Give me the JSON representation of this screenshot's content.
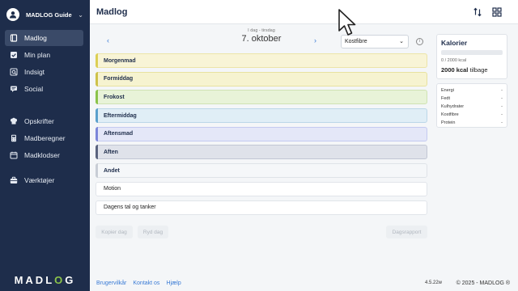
{
  "sidebar": {
    "user_name": "MADLOG Guide",
    "items": [
      {
        "label": "Madlog",
        "icon": "book-icon",
        "active": true
      },
      {
        "label": "Min plan",
        "icon": "checkbox-icon",
        "active": false
      },
      {
        "label": "Indsigt",
        "icon": "insight-icon",
        "active": false
      },
      {
        "label": "Social",
        "icon": "social-icon",
        "active": false
      },
      {
        "label": "Opskrifter",
        "icon": "chef-hat-icon",
        "active": false
      },
      {
        "label": "Madberegner",
        "icon": "calculator-icon",
        "active": false
      },
      {
        "label": "Madklodser",
        "icon": "calendar-icon",
        "active": false
      },
      {
        "label": "Værktøjer",
        "icon": "toolbox-icon",
        "active": false
      }
    ],
    "brand": {
      "part1": "MADL",
      "o": "O",
      "part2": "G"
    }
  },
  "header": {
    "title": "Madlog",
    "icons": [
      "sort-icon",
      "grid-icon"
    ]
  },
  "date_nav": {
    "sub": "I dag - tirsdag",
    "date": "7. oktober",
    "prev": "‹",
    "next": "›"
  },
  "nutrient_select": {
    "value": "Kostfibre"
  },
  "meals": [
    {
      "label": "Morgenmad"
    },
    {
      "label": "Formiddag"
    },
    {
      "label": "Frokost"
    },
    {
      "label": "Eftermiddag"
    },
    {
      "label": "Aftensmad"
    },
    {
      "label": "Aften"
    },
    {
      "label": "Andet"
    },
    {
      "label": "Motion"
    },
    {
      "label": "Dagens tal og tanker"
    }
  ],
  "actions": {
    "copy": "Kopier dag",
    "clear": "Ryd dag",
    "report": "Dagsrapport"
  },
  "calories": {
    "title": "Kalorier",
    "progress": "0 / 2000 kcal",
    "progress_fraction": 0,
    "remaining_value": "2000 kcal",
    "remaining_label": "tilbage"
  },
  "nutrients": [
    {
      "name": "Energi",
      "value": "-"
    },
    {
      "name": "Fedt",
      "value": "-"
    },
    {
      "name": "Kulhydrater",
      "value": "-"
    },
    {
      "name": "Kostfibre",
      "value": "-"
    },
    {
      "name": "Protein",
      "value": "-"
    }
  ],
  "footer": {
    "links": [
      "Brugervilkår",
      "Kontakt os",
      "Hjælp"
    ],
    "version": "4.5.22w",
    "copyright": "© 2025 - MADLOG ®"
  },
  "colors": {
    "sidebar": "#1e2d4b",
    "accent": "#8bc34a",
    "link": "#3a7bd5"
  }
}
